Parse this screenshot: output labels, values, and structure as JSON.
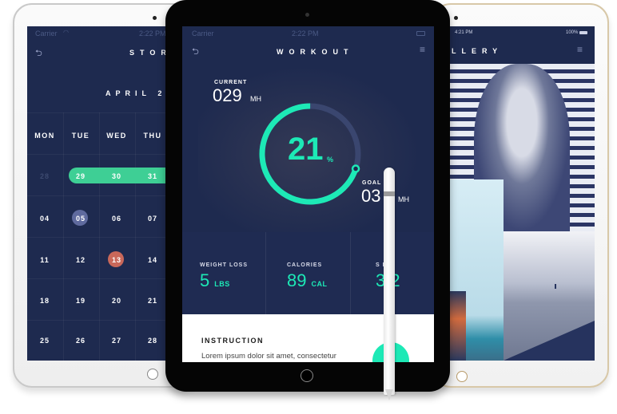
{
  "left_tablet": {
    "status": {
      "carrier": "Carrier",
      "time": "2:22 PM"
    },
    "header": {
      "title": "STOR",
      "back_icon": "back-arrow-icon"
    },
    "month_label": "APRIL 2",
    "day_names": [
      "MON",
      "TUE",
      "WED",
      "THU"
    ],
    "weeks": [
      [
        "28",
        "29",
        "30",
        "31"
      ],
      [
        "04",
        "05",
        "06",
        "07"
      ],
      [
        "11",
        "12",
        "13",
        "14"
      ],
      [
        "18",
        "19",
        "20",
        "21"
      ],
      [
        "25",
        "26",
        "27",
        "28"
      ]
    ],
    "range_selection": [
      "29",
      "30",
      "31"
    ],
    "highlight_blue": "05",
    "highlight_red": "13",
    "colors": {
      "accent": "#3ecf95",
      "blue": "#5f6a9e",
      "red": "#c9685a",
      "bg": "#1e2a4f"
    }
  },
  "center_tablet": {
    "status": {
      "carrier": "Carrier",
      "time": "2:22 PM"
    },
    "header": {
      "title": "WORKOUT",
      "back_icon": "back-arrow-icon",
      "menu_icon": "hamburger-menu-icon"
    },
    "current": {
      "label": "CURRENT",
      "value": "029",
      "unit": "MH"
    },
    "progress": {
      "value": "21",
      "unit": "%",
      "fraction": 0.21
    },
    "goal": {
      "label": "GOAL",
      "value": "03",
      "unit": "MH"
    },
    "stats": [
      {
        "label": "WEIGHT LOSS",
        "value": "5",
        "unit": "LBS"
      },
      {
        "label": "CALORIES",
        "value": "89",
        "unit": "CAL"
      },
      {
        "label": "S  RE",
        "value": "3 2",
        "unit": ""
      }
    ],
    "instruction": {
      "title": "INSTRUCTION",
      "text": "Lorem ipsum dolor sit amet, consectetur"
    },
    "colors": {
      "accent": "#1de9b6",
      "bg": "#1e2a4f"
    }
  },
  "right_tablet": {
    "status": {
      "time": "4:21 PM",
      "battery": "100%"
    },
    "header": {
      "title": "LLERY",
      "menu_icon": "hamburger-menu-icon"
    }
  }
}
